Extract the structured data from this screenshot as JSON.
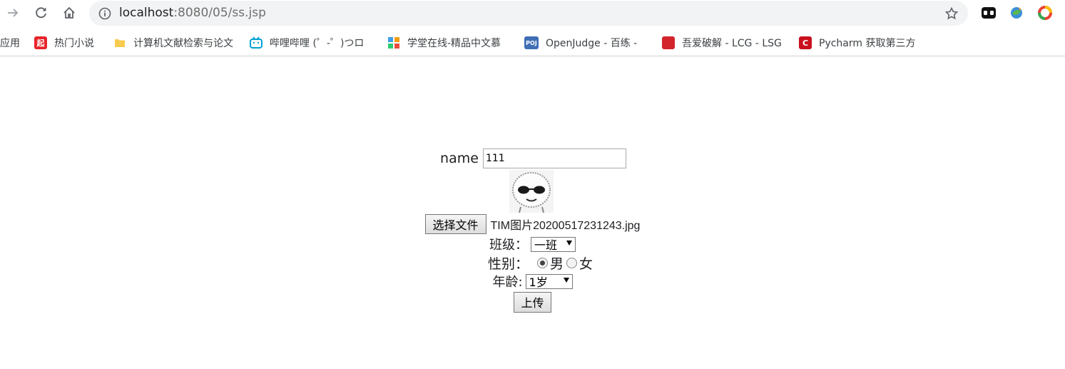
{
  "browser": {
    "url_host": "localhost",
    "url_path": ":8080/05/ss.jsp",
    "bookmarks": [
      {
        "label": "应用",
        "icon": "apps-icon",
        "color": "#4285f4"
      },
      {
        "label": "热门小说",
        "icon": "qidian-icon",
        "color": "#e8232a",
        "glyph": "起"
      },
      {
        "label": "计算机文献检索与论文",
        "icon": "folder-icon",
        "color": "#f7cb4d"
      },
      {
        "label": "哔哩哔哩 (゜-゜)つロ",
        "icon": "bilibili-icon",
        "color": "#00a1d6"
      },
      {
        "label": "学堂在线-精品中文慕",
        "icon": "xuetangx-icon",
        "color": "#3ca0e8"
      },
      {
        "label": "OpenJudge - 百练 -",
        "icon": "poj-icon",
        "color": "#3f6eb5",
        "glyph": "POJ"
      },
      {
        "label": "吾爱破解 - LCG - LSG",
        "icon": "52pojie-icon",
        "color": "#d3242b"
      },
      {
        "label": "Pycharm 获取第三方",
        "icon": "csdn-icon",
        "color": "#c9101c",
        "glyph": "C"
      }
    ]
  },
  "form": {
    "name_label": "name",
    "name_value": "111",
    "file_button_label": "选择文件",
    "file_name": "TIM图片20200517231243.jpg",
    "class_label": "班级：",
    "class_selected": "一班",
    "gender_label": "性别：",
    "gender_options": [
      "男",
      "女"
    ],
    "gender_selected": "男",
    "age_label": "年龄:",
    "age_selected": "1岁",
    "submit_label": "上传"
  }
}
